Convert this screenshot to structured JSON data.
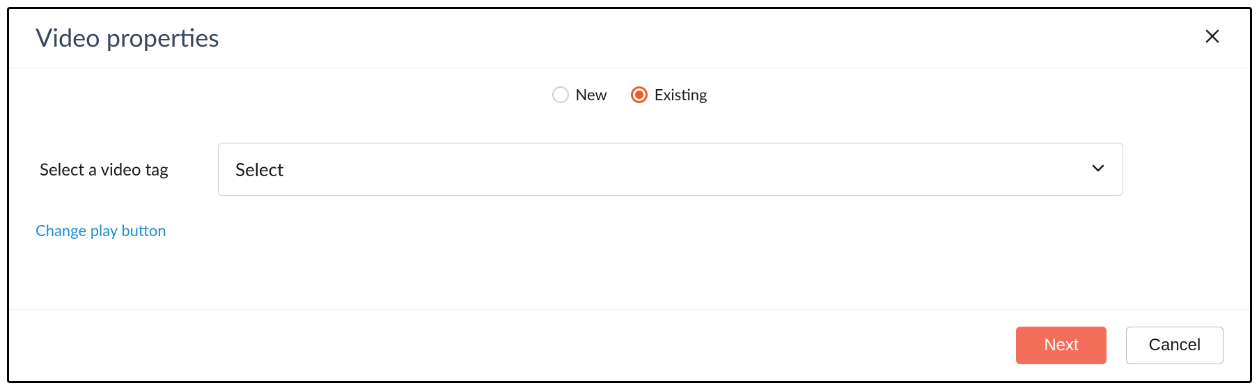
{
  "dialog": {
    "title": "Video properties"
  },
  "radios": {
    "new_label": "New",
    "existing_label": "Existing",
    "selected": "existing"
  },
  "form": {
    "select_label": "Select a video tag",
    "select_value": "Select"
  },
  "link": {
    "change_play": "Change play button"
  },
  "buttons": {
    "next": "Next",
    "cancel": "Cancel"
  }
}
